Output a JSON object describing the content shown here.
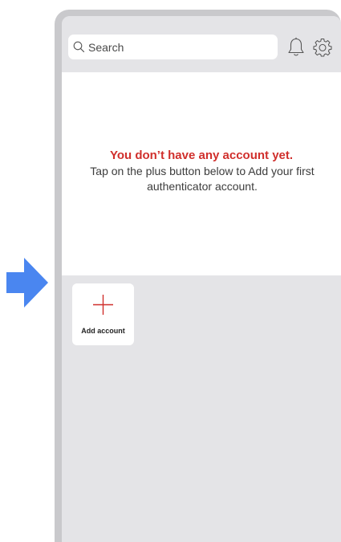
{
  "search": {
    "placeholder": "Search"
  },
  "header": {
    "icons": [
      "search-icon",
      "bell-icon",
      "gear-icon"
    ]
  },
  "empty_state": {
    "title": "You don’t have any account yet.",
    "message": "Tap on the plus button below to Add your first authenticator account."
  },
  "add_tile": {
    "label": "Add account",
    "icon": "plus-icon"
  },
  "colors": {
    "accent_red": "#d02f2c",
    "pointer_blue": "#4a86f0",
    "frame_gray": "#c9c9cc",
    "screen_gray": "#e4e4e7"
  }
}
